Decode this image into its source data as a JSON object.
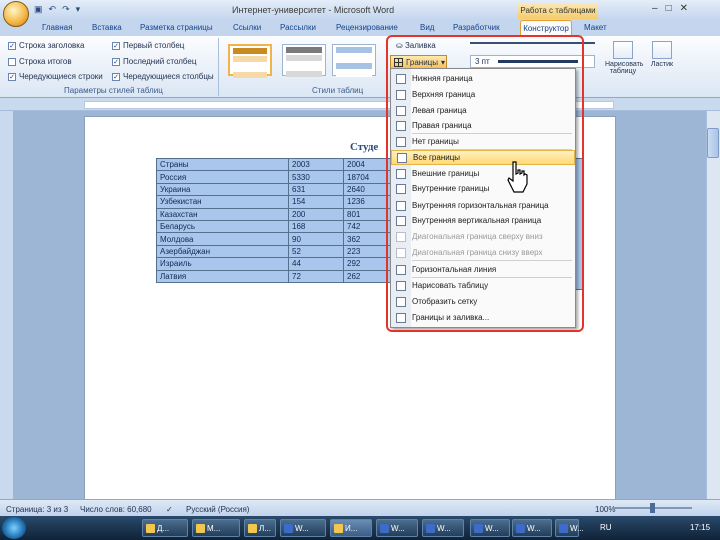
{
  "window": {
    "title": "Интернет-университет - Microsoft Word",
    "context_title": "Работа с таблицами",
    "controls": [
      "–",
      "□",
      "✕"
    ]
  },
  "qat": {
    "undo": "↶",
    "redo": "↷",
    "more": "▾"
  },
  "tabs": [
    "Главная",
    "Вставка",
    "Разметка страницы",
    "Ссылки",
    "Рассылки",
    "Рецензирование",
    "Вид",
    "Разработчик",
    "Конструктор",
    "Макет"
  ],
  "ribbon": {
    "style_options": [
      {
        "label": "Строка заголовка",
        "checked": true
      },
      {
        "label": "Строка итогов",
        "checked": false
      },
      {
        "label": "Чередующиеся строки",
        "checked": true
      },
      {
        "label": "Первый столбец",
        "checked": true
      },
      {
        "label": "Последний столбец",
        "checked": false
      },
      {
        "label": "Чередующиеся столбцы",
        "checked": false
      }
    ],
    "group_style_options_label": "Параметры стилей таблиц",
    "group_styles_label": "Стили таблиц",
    "fill_label": "Заливка",
    "borders_label": "Границы",
    "pen_weight": "3 пт",
    "draw_table_label": "Нарисовать таблицу",
    "eraser_label": "Ластик"
  },
  "document": {
    "heading": "Студе",
    "table": [
      [
        "Страны",
        "2003",
        "2004"
      ],
      [
        "Россия",
        "5330",
        "18704"
      ],
      [
        "Украина",
        "631",
        "2640"
      ],
      [
        "Узбекистан",
        "154",
        "1236"
      ],
      [
        "Казахстан",
        "200",
        "801"
      ],
      [
        "Беларусь",
        "168",
        "742"
      ],
      [
        "Молдова",
        "90",
        "362"
      ],
      [
        "Азербайджан",
        "52",
        "223"
      ],
      [
        "Израиль",
        "44",
        "292"
      ],
      [
        "Латвия",
        "72",
        "262"
      ]
    ]
  },
  "borders_menu": [
    {
      "label": "Нижняя граница",
      "state": "normal"
    },
    {
      "label": "Верхняя граница",
      "state": "normal"
    },
    {
      "label": "Левая граница",
      "state": "normal"
    },
    {
      "label": "Правая граница",
      "state": "normal"
    },
    {
      "label": "Нет границы",
      "state": "normal"
    },
    {
      "label": "Все границы",
      "state": "highlighted"
    },
    {
      "label": "Внешние границы",
      "state": "normal"
    },
    {
      "label": "Внутренние границы",
      "state": "normal"
    },
    {
      "label": "Внутренняя горизонтальная граница",
      "state": "normal"
    },
    {
      "label": "Внутренняя вертикальная граница",
      "state": "normal"
    },
    {
      "label": "Диагональная граница сверху вниз",
      "state": "disabled"
    },
    {
      "label": "Диагональная граница снизу вверх",
      "state": "disabled"
    },
    {
      "label": "Горизонтальная линия",
      "state": "normal"
    },
    {
      "label": "Нарисовать таблицу",
      "state": "normal"
    },
    {
      "label": "Отобразить сетку",
      "state": "normal"
    },
    {
      "label": "Границы и заливка...",
      "state": "normal"
    }
  ],
  "status": {
    "page": "Страница: 3 из 3",
    "words": "Число слов: 60,680",
    "language": "Русский (Россия)",
    "zoom": "100%"
  },
  "taskbar": {
    "buttons": [
      "Д...",
      "М...",
      "Л...",
      "W...",
      "И...",
      "W...",
      "W...",
      "W...",
      "W...",
      "W..."
    ],
    "lang": "RU",
    "time": "17:15"
  },
  "colors": {
    "accent": "#f5cc6c",
    "ribbon": "#dbe6f4",
    "highlight": "#ffd972",
    "annotation": "#e2342a"
  }
}
